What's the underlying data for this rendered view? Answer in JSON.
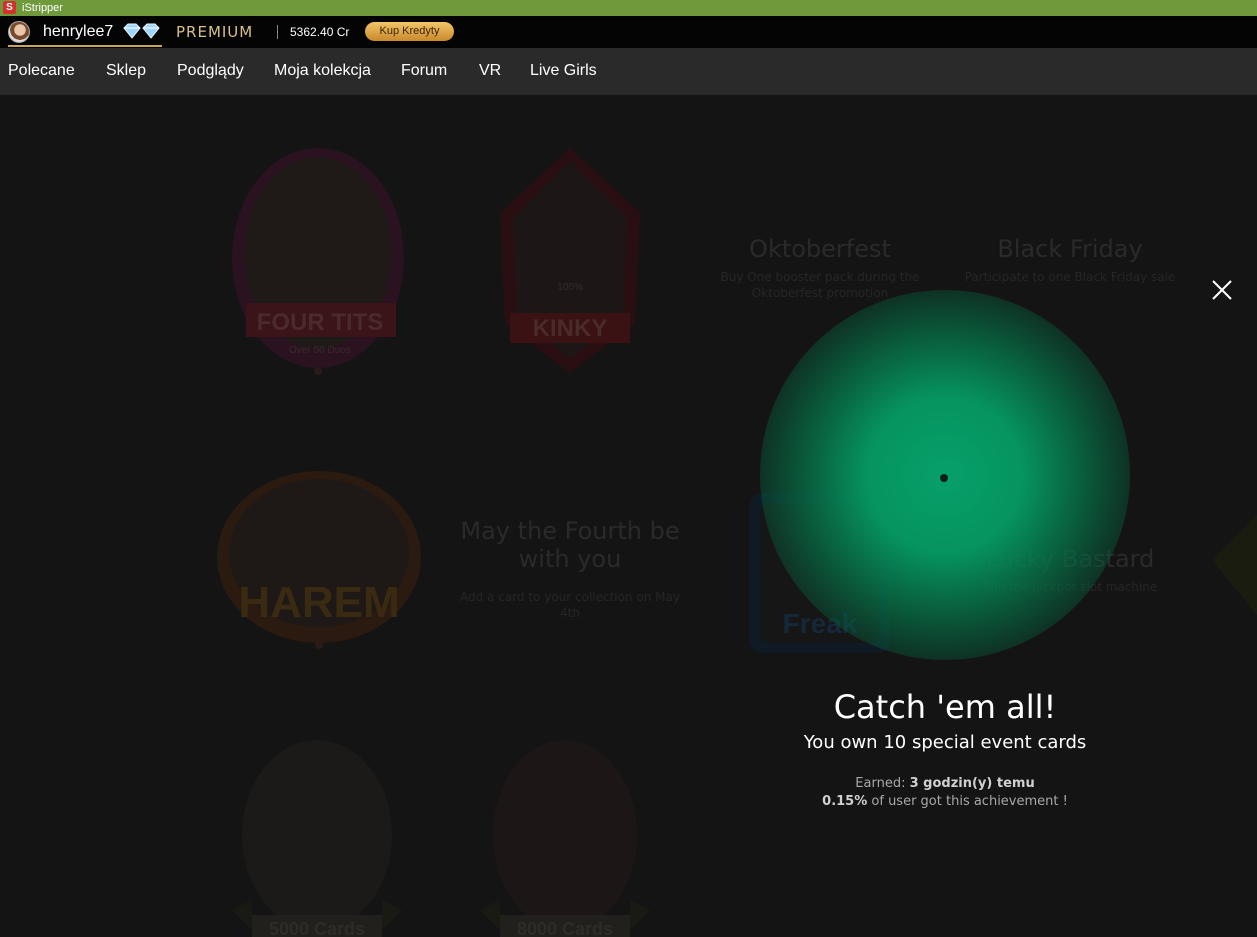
{
  "window": {
    "title": "iStripper",
    "app_icon": "S"
  },
  "userbar": {
    "username": "henrylee7",
    "tier": "PREMIUM",
    "credits": "5362.40 Cr",
    "buy_label": "Kup Kredyty"
  },
  "nav": {
    "items": [
      "Polecane",
      "Sklep",
      "Podglądy",
      "Moja kolekcja",
      "Forum",
      "VR",
      "Live Girls"
    ]
  },
  "background_badges": {
    "four_tits": {
      "title": "FOUR TITS",
      "sub": "Over 50 Duos"
    },
    "kinky": {
      "title": "KINKY",
      "sub": "100%"
    },
    "harem": {
      "title": "HAREM"
    },
    "freak": {
      "title": "Freak"
    },
    "cards1": {
      "title": "5000 Cards"
    },
    "cards2": {
      "title": "8000 Cards"
    }
  },
  "background_achievements": {
    "oktoberfest": {
      "title": "Oktoberfest",
      "desc": "Buy One booster pack during the Oktoberfest promotion"
    },
    "black_friday": {
      "title": "Black Friday",
      "desc": "Participate to one Black Friday sale"
    },
    "may_fourth": {
      "title": "May the Fourth be with you",
      "desc": "Add a card to your collection on May 4th"
    },
    "lucky_bastard": {
      "title": "Lucky Bastard",
      "desc": "Win the jackpot slot machine"
    }
  },
  "popup": {
    "title": "Catch 'em all!",
    "subtitle": "You own 10 special event cards",
    "earned_label": "Earned:",
    "earned_value": "3 godzin(y) temu",
    "percent_value": "0.15%",
    "percent_label": "of user got this achievement !"
  },
  "colors": {
    "accent_gold": "#c9a55a",
    "glow_green": "#07a06a",
    "titlebar": "#6e9a3c"
  }
}
